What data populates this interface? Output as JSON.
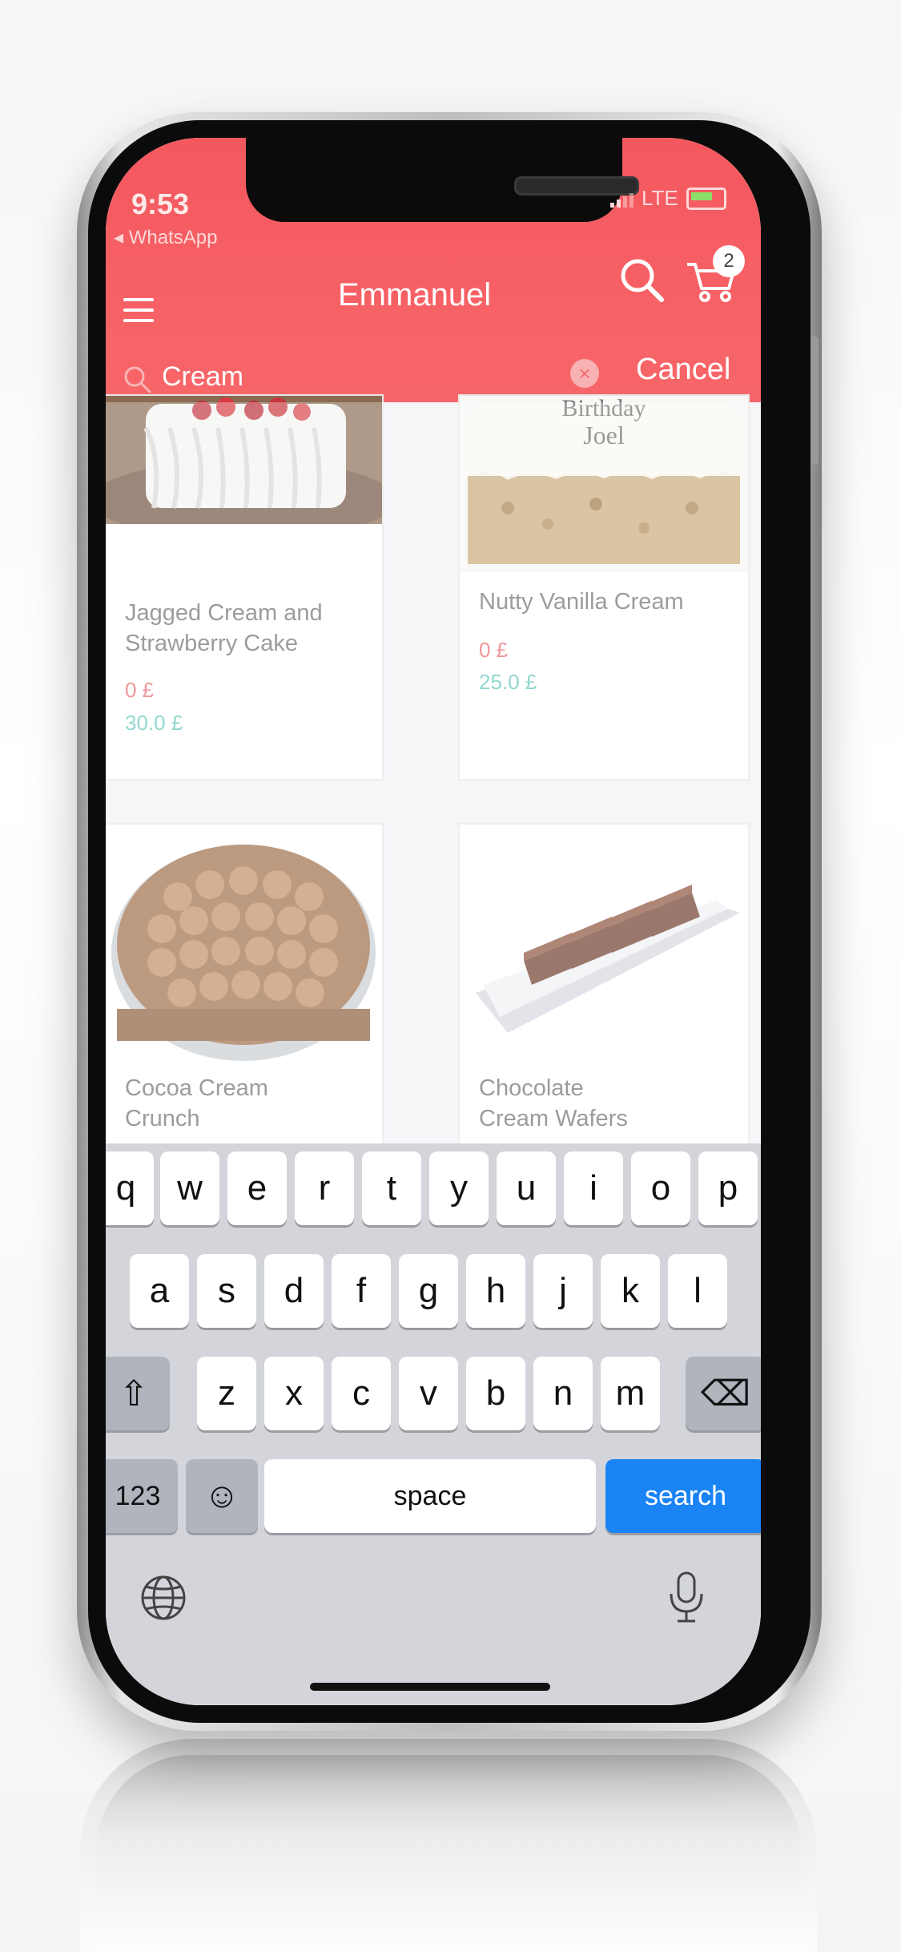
{
  "status_bar": {
    "time": "9:53",
    "back_app": "◂ WhatsApp",
    "network": "LTE"
  },
  "header": {
    "title": "Emmanuel",
    "cart_count": "2"
  },
  "search": {
    "query": "Cream",
    "cancel_label": "Cancel",
    "clear_glyph": "×"
  },
  "products": [
    {
      "name_line1": "Jagged Cream and",
      "name_line2": "Strawberry Cake",
      "sale_price": "0 £",
      "price": "30.0 £"
    },
    {
      "name_line1": "Nutty Vanilla Cream",
      "name_line2": "",
      "sale_price": "0 £",
      "price": "25.0 £",
      "image_text_line1": "Birthday",
      "image_text_line2": "Joel"
    },
    {
      "name_line1": "Cocoa Cream",
      "name_line2": "Crunch"
    },
    {
      "name_line1": "Chocolate",
      "name_line2": "Cream Wafers"
    }
  ],
  "keyboard": {
    "row1": [
      "q",
      "w",
      "e",
      "r",
      "t",
      "y",
      "u",
      "i",
      "o",
      "p"
    ],
    "row2": [
      "a",
      "s",
      "d",
      "f",
      "g",
      "h",
      "j",
      "k",
      "l"
    ],
    "row3": [
      "z",
      "x",
      "c",
      "v",
      "b",
      "n",
      "m"
    ],
    "shift_glyph": "⇧",
    "delete_glyph": "⌫",
    "numbers_label": "123",
    "emoji_glyph": "☺",
    "space_label": "space",
    "search_label": "search"
  },
  "colors": {
    "header": "#f55d62",
    "sale_price": "#e9666a",
    "price": "#5fc5b8",
    "search_key": "#1a84f5"
  },
  "icons": [
    "menu-icon",
    "search-icon",
    "cart-icon",
    "clear-icon",
    "globe-icon",
    "microphone-icon",
    "shift-icon",
    "delete-icon",
    "emoji-icon"
  ]
}
